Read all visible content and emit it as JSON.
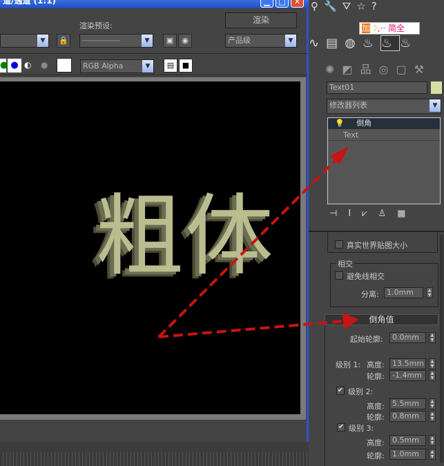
{
  "window": {
    "title": "道/通道 (1:1)",
    "min": "▁",
    "max": "□",
    "close": "✕"
  },
  "toolbar": {
    "preset_label": "渲染预设:",
    "preset_value": "-------------------",
    "render_button": "渲染",
    "quality_value": "产品级",
    "channel_value": "RGB Alpha"
  },
  "panel": {
    "object_name": "Text01",
    "object_color": "#d4dfa4",
    "modifier_list": "修改器列表",
    "stack": [
      "倒角",
      "Text"
    ],
    "ime": "简全"
  },
  "mapping": {
    "real_world": "真实世界贴图大小"
  },
  "intersect": {
    "group": "相交",
    "avoid": "避免线相交",
    "sep_label": "分离:",
    "sep_value": "1.0mm"
  },
  "bevel": {
    "title": "倒角值",
    "start_label": "起始轮廓:",
    "start_value": "0.0mm",
    "levels": [
      {
        "label": "级别 1:",
        "checked": null,
        "height_label": "高度:",
        "height": "13.5mm",
        "outline_label": "轮廓:",
        "outline": "-1.4mm"
      },
      {
        "label": "级别 2:",
        "checked": true,
        "height_label": "高度:",
        "height": "5.5mm",
        "outline_label": "轮廓:",
        "outline": "0.8mm"
      },
      {
        "label": "级别 3:",
        "checked": true,
        "height_label": "高度:",
        "height": "0.5mm",
        "outline_label": "轮廓:",
        "outline": "1.0mm"
      }
    ]
  },
  "render": {
    "text": "粗体"
  },
  "colors": {
    "arrow": "#c81414",
    "title_blue": "#2a55c8"
  }
}
